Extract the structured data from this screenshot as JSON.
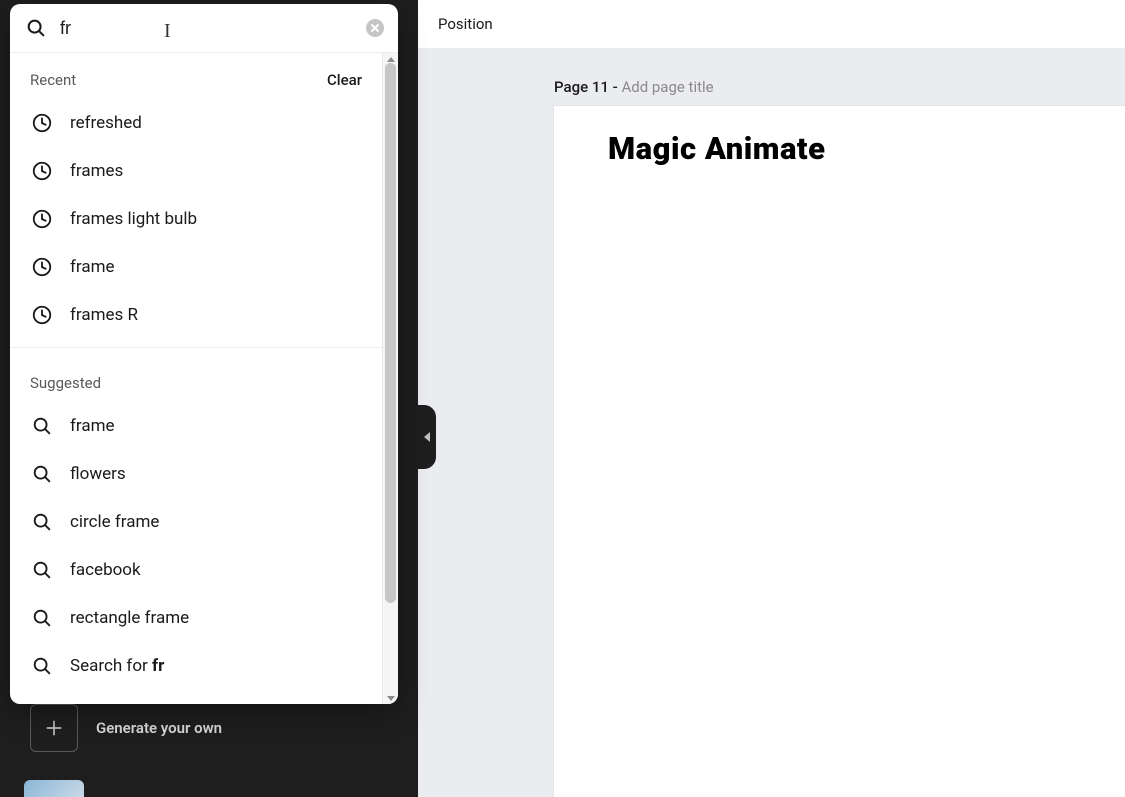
{
  "toolbar": {
    "position_label": "Position"
  },
  "page": {
    "label": "Page 11 - ",
    "title_placeholder": "Add page title",
    "heading": "Magic Animate"
  },
  "sidebar": {
    "generate_label": "Generate your own"
  },
  "search": {
    "query": "fr",
    "recent_label": "Recent",
    "clear_label": "Clear",
    "recent": [
      {
        "label": "refreshed"
      },
      {
        "label": "frames"
      },
      {
        "label": "frames light bulb"
      },
      {
        "label": "frame"
      },
      {
        "label": "frames R"
      }
    ],
    "suggested_label": "Suggested",
    "suggested": [
      {
        "label": "frame"
      },
      {
        "label": "flowers"
      },
      {
        "label": "circle frame"
      },
      {
        "label": "facebook"
      },
      {
        "label": "rectangle frame"
      }
    ],
    "search_for_prefix": "Search for ",
    "search_for_query": "fr"
  }
}
